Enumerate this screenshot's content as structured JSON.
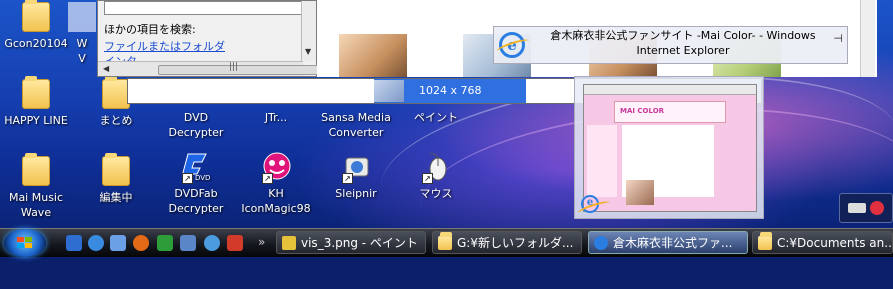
{
  "desktop_icons": [
    {
      "id": "gcon",
      "label": "Gcon20104",
      "type": "folder"
    },
    {
      "id": "w-partial",
      "label": "W\nV",
      "type": "folder"
    },
    {
      "id": "happy-line",
      "label": "HAPPY LINE",
      "type": "folder"
    },
    {
      "id": "matome",
      "label": "まとめ",
      "type": "folder"
    },
    {
      "id": "dvd-decrypter",
      "label": "DVD\nDecrypter",
      "type": "app"
    },
    {
      "id": "jtr",
      "label": "JTr...",
      "type": "app"
    },
    {
      "id": "sansa",
      "label": "Sansa Media\nConverter",
      "type": "app"
    },
    {
      "id": "paint",
      "label": "ペイント",
      "type": "app"
    },
    {
      "id": "mai-music-wave",
      "label": "Mai Music\nWave",
      "type": "folder"
    },
    {
      "id": "henshuchu",
      "label": "編集中",
      "type": "folder"
    },
    {
      "id": "dvdfab",
      "label": "DVDFab\nDecrypter",
      "type": "shortcut"
    },
    {
      "id": "kh-iconmagic",
      "label": "KH\nIconMagic98",
      "type": "shortcut"
    },
    {
      "id": "sleipnir",
      "label": "Sleipnir",
      "type": "shortcut"
    },
    {
      "id": "mouse",
      "label": "マウス",
      "type": "shortcut"
    }
  ],
  "explorer": {
    "search_label": "ほかの項目を検索:",
    "link": "ファイルまたはフォルダ",
    "link2": "インターネット"
  },
  "thumbnail_tooltip": {
    "title": "倉木麻衣非公式ファンサイト -Mai Color- - Windows Internet Explorer",
    "pin_glyph": "⊣"
  },
  "preview": {
    "site_logo": "MAI COLOR"
  },
  "image_strip": {
    "resolution": "1024 x 768"
  },
  "taskbar": {
    "overflow": "»",
    "buttons": [
      {
        "label": "vis_3.png - ペイント",
        "icon": "paint-icon",
        "active": false
      },
      {
        "label": "G:¥新しいフォルダ...",
        "icon": "folder-icon",
        "active": false
      },
      {
        "label": "倉木麻衣非公式ファ...",
        "icon": "ie-icon",
        "active": true
      },
      {
        "label": "C:¥Documents an...",
        "icon": "folder-icon",
        "active": false
      }
    ]
  },
  "colors": {
    "selection": "#2f6fe0",
    "accent": "#2a7de1"
  }
}
